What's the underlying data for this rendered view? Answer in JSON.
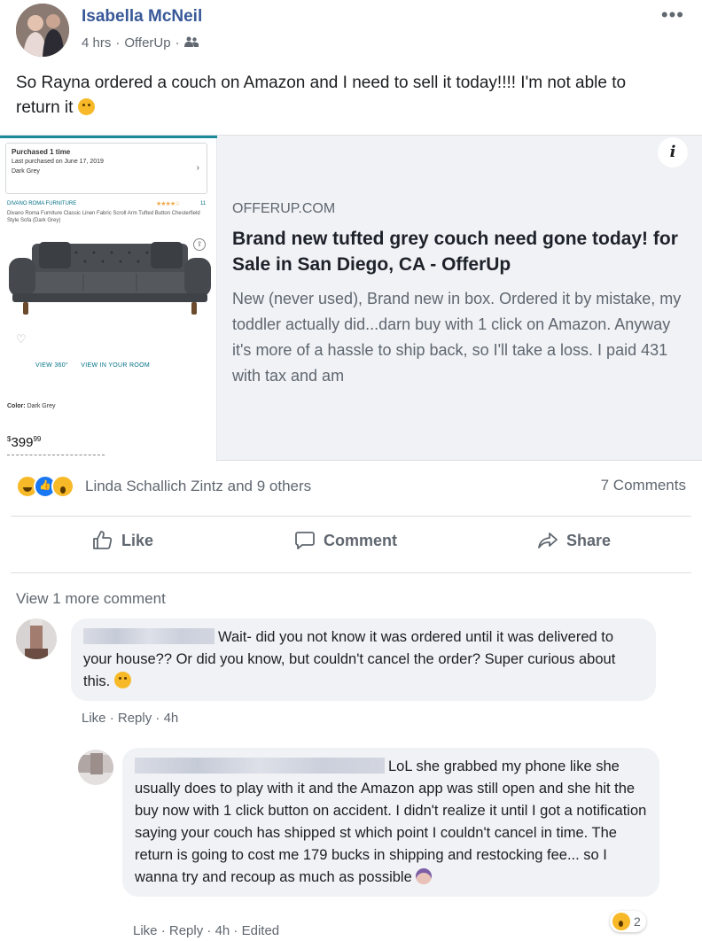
{
  "post": {
    "author": "Isabella McNeil",
    "time": "4 hrs",
    "via": "OfferUp",
    "audience_icon": "friends-icon",
    "more_icon": "ellipsis-icon",
    "text": "So Rayna ordered a couch on Amazon and I need to sell it today!!!! I'm not able to return it",
    "text_emoji": "confused-emoji"
  },
  "link": {
    "domain": "OFFERUP.COM",
    "title": "Brand new tufted grey couch need gone today! for Sale in San Diego, CA - OfferUp",
    "description": "New (never used), Brand new in box. Ordered it by mistake, my toddler actually did...darn buy with 1 click on Amazon. Anyway it's more of a hassle to ship back, so I'll take a loss. I paid 431 with tax and am",
    "info_icon": "info-icon",
    "product": {
      "purchased": "Purchased 1 time",
      "last_purchased": "Last purchased on June 17, 2019",
      "variant": "Dark Grey",
      "brand": "DIVANO ROMA FURNITURE",
      "stars_count": "11",
      "desc": "Divano Roma Furniture Classic Linen Fabric Scroll Arm Tufted Button Chesterfield Style Sofa (Dark Grey)",
      "view_360": "VIEW 360°",
      "view_room": "VIEW IN YOUR ROOM",
      "color_label": "Color:",
      "color_value": "Dark Grey",
      "price_symbol": "$",
      "price": "399",
      "price_cents": "99"
    }
  },
  "reactions": {
    "names": "Linda Schallich Zintz and 9 others",
    "comments": "7 Comments",
    "types": [
      "haha",
      "like",
      "wow"
    ]
  },
  "actions": {
    "like": "Like",
    "comment": "Comment",
    "share": "Share"
  },
  "comments": {
    "view_more": "View 1 more comment",
    "items": [
      {
        "text": "Wait- did you not know it was ordered until it was delivered to your house?? Or did you know, but couldn't cancel the order? Super curious about this.",
        "emoji": "grinning-emoji",
        "like": "Like",
        "reply": "Reply",
        "time": "4h"
      },
      {
        "text": "LoL she grabbed my phone like she usually does to play with it and the Amazon app was still open and she hit the buy now with 1 click button on accident. I didn't realize it until I got a notification saying your couch has shipped st which point I couldn't cancel in time. The return is going to cost me 179 bucks in shipping and restocking fee... so I wanna try and recoup as much as possible",
        "emoji": "person-emoji",
        "like": "Like",
        "reply": "Reply",
        "time": "4h",
        "edited": "Edited",
        "reaction_count": "2"
      }
    ]
  },
  "colors": {
    "name_blue": "#385898",
    "muted": "#606770",
    "bubble": "#f0f2f5",
    "card_bg": "#f0f2f5"
  }
}
